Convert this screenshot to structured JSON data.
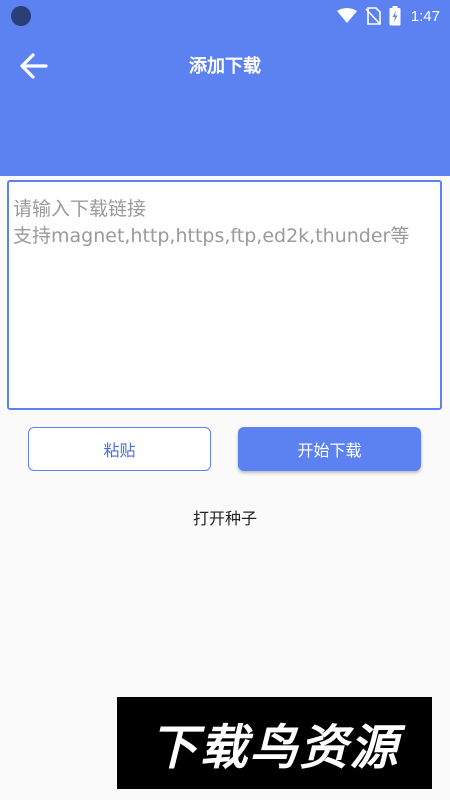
{
  "status_bar": {
    "time": "1:47",
    "icons": [
      "wifi-icon",
      "no-sim-icon",
      "battery-charging-icon"
    ]
  },
  "header": {
    "title": "添加下载",
    "back_icon": "arrow-left-icon"
  },
  "link_input": {
    "value": "",
    "placeholder": "请输入下载链接\n支持magnet,http,https,ftp,ed2k,thunder等"
  },
  "buttons": {
    "paste_label": "粘贴",
    "start_label": "开始下载"
  },
  "open_torrent_label": "打开种子",
  "watermark": {
    "text": "下载鸟资源"
  },
  "colors": {
    "primary": "#5b82f0",
    "status_dot": "#2a3e78",
    "background": "#fafafa"
  }
}
